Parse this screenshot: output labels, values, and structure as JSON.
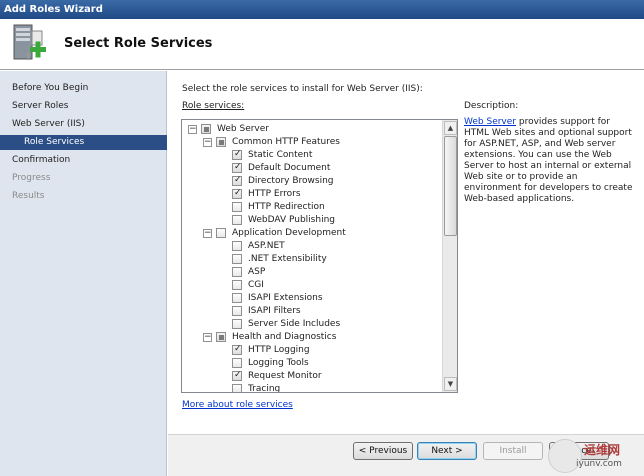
{
  "window": {
    "title": "Add Roles Wizard"
  },
  "header": {
    "title": "Select Role Services"
  },
  "nav": {
    "items": [
      {
        "label": "Before You Begin",
        "state": "normal"
      },
      {
        "label": "Server Roles",
        "state": "normal"
      },
      {
        "label": "Web Server (IIS)",
        "state": "normal"
      },
      {
        "label": "Role Services",
        "state": "active"
      },
      {
        "label": "Confirmation",
        "state": "normal"
      },
      {
        "label": "Progress",
        "state": "disabled"
      },
      {
        "label": "Results",
        "state": "disabled"
      }
    ]
  },
  "main": {
    "instruction": "Select the role services to install for Web Server (IIS):",
    "role_services_label": "Role services:",
    "tree": [
      {
        "label": "Web Server",
        "level": 0,
        "expander": "−",
        "state": "partial"
      },
      {
        "label": "Common HTTP Features",
        "level": 1,
        "expander": "−",
        "state": "partial"
      },
      {
        "label": "Static Content",
        "level": 2,
        "state": "checked"
      },
      {
        "label": "Default Document",
        "level": 2,
        "state": "checked"
      },
      {
        "label": "Directory Browsing",
        "level": 2,
        "state": "checked"
      },
      {
        "label": "HTTP Errors",
        "level": 2,
        "state": "checked"
      },
      {
        "label": "HTTP Redirection",
        "level": 2,
        "state": "unchecked"
      },
      {
        "label": "WebDAV Publishing",
        "level": 2,
        "state": "unchecked"
      },
      {
        "label": "Application Development",
        "level": 1,
        "expander": "−",
        "state": "unchecked"
      },
      {
        "label": "ASP.NET",
        "level": 2,
        "state": "unchecked"
      },
      {
        "label": ".NET Extensibility",
        "level": 2,
        "state": "unchecked"
      },
      {
        "label": "ASP",
        "level": 2,
        "state": "unchecked"
      },
      {
        "label": "CGI",
        "level": 2,
        "state": "unchecked"
      },
      {
        "label": "ISAPI Extensions",
        "level": 2,
        "state": "unchecked"
      },
      {
        "label": "ISAPI Filters",
        "level": 2,
        "state": "unchecked"
      },
      {
        "label": "Server Side Includes",
        "level": 2,
        "state": "unchecked"
      },
      {
        "label": "Health and Diagnostics",
        "level": 1,
        "expander": "−",
        "state": "partial"
      },
      {
        "label": "HTTP Logging",
        "level": 2,
        "state": "checked"
      },
      {
        "label": "Logging Tools",
        "level": 2,
        "state": "unchecked"
      },
      {
        "label": "Request Monitor",
        "level": 2,
        "state": "checked"
      },
      {
        "label": "Tracing",
        "level": 2,
        "state": "unchecked"
      }
    ],
    "more_link": "More about role services",
    "description_title": "Description:",
    "description_link": "Web Server",
    "description_text": " provides support for HTML Web sites and optional support for ASP.NET, ASP, and Web server extensions. You can use the Web Server to host an internal or external Web site or to provide an environment for developers to create Web-based applications."
  },
  "footer": {
    "previous": "< Previous",
    "next": "Next >",
    "install": "Install",
    "cancel": "Cancel"
  },
  "watermark": {
    "line1": "运维网",
    "line2": "iyunv.com"
  }
}
